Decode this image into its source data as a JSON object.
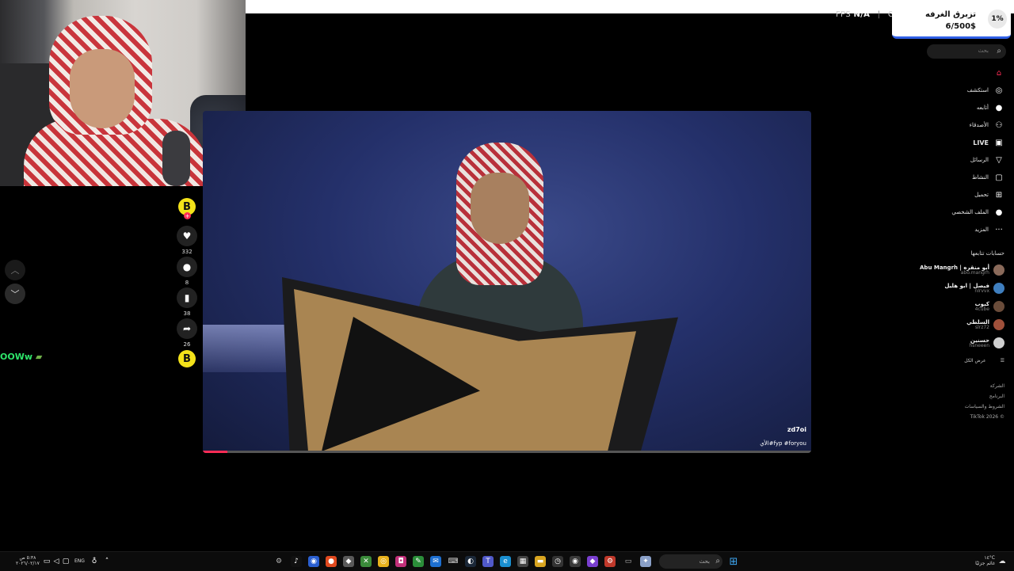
{
  "overlay": {
    "fps_label": "FPS",
    "fps_value": "N/A",
    "fps_sep": "|",
    "gp_label": "GP"
  },
  "donation": {
    "percent": "1%",
    "title": "تزبرق الغرفه",
    "amount": "6/500$"
  },
  "feed": {
    "chat_text": "OOWw",
    "actions": {
      "like_count": "332",
      "comment_count": "8",
      "save_count": "38",
      "share_count": "26"
    },
    "badge_letter": "B",
    "plus": "+"
  },
  "video": {
    "author": "zd7oi",
    "caption": "الأي#fyp #foryou",
    "progress_fraction": 0.04
  },
  "sidebar": {
    "search_placeholder": "بحث",
    "nav": [
      {
        "label": "",
        "icon": "home-icon",
        "glyph": "⌂",
        "active": true
      },
      {
        "label": "استكشف",
        "icon": "compass-icon",
        "glyph": "◎"
      },
      {
        "label": "أتابعه",
        "icon": "following-icon",
        "glyph": "●"
      },
      {
        "label": "الأصدقاء",
        "icon": "friends-icon",
        "glyph": "⚇"
      },
      {
        "label": "LIVE",
        "icon": "live-icon",
        "glyph": "▣"
      },
      {
        "label": "الرسائل",
        "icon": "messages-icon",
        "glyph": "▽"
      },
      {
        "label": "النشاط",
        "icon": "activity-icon",
        "glyph": "▢"
      },
      {
        "label": "تحميل",
        "icon": "upload-icon",
        "glyph": "⊞"
      },
      {
        "label": "الملف الشخصي",
        "icon": "profile-icon",
        "glyph": "●"
      },
      {
        "label": "المزيد",
        "icon": "more-icon",
        "glyph": "···"
      }
    ],
    "following_header": "حسابات تتابعها",
    "following": [
      {
        "name": "Abu Mangrh | أبو منقره",
        "user": "abo.mangrh",
        "color": "#8a6a5a"
      },
      {
        "name": "فيصل | ابو هليل",
        "user": "nlrvvx",
        "color": "#3f7fbf"
      },
      {
        "name": "كيوب",
        "user": "4cube",
        "color": "#6a4c3a"
      },
      {
        "name": "السلطي",
        "user": "slrz72",
        "color": "#a0503a"
      },
      {
        "name": "حسنين",
        "user": "hsneeen",
        "color": "#cfcfcf"
      }
    ],
    "see_all": "عرض الكل",
    "footer": [
      "الشركة",
      "البرنامج",
      "الشروط والسياسات",
      "TikTok 2026 ©"
    ]
  },
  "taskbar": {
    "time": "٥:٣٨ ص",
    "date": "٢٠٢٦/٠٢/١٧",
    "lang": "ENG",
    "search_placeholder": "بحث",
    "weather_temp": "١٤°C",
    "weather_desc": "غائم جزئيًا"
  },
  "colors": {
    "tiktok_red": "#fe2c55",
    "chat_green": "#2ee56a",
    "badge_yellow": "#f3e21a",
    "donation_blue": "#2f5fe6"
  }
}
